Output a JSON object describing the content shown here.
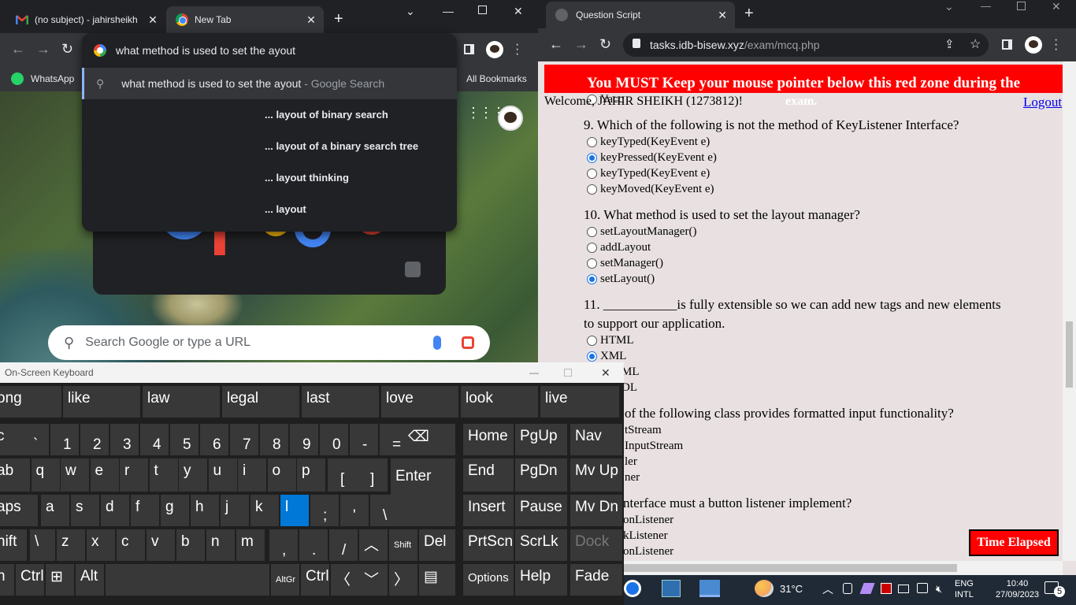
{
  "left_browser": {
    "tabs": [
      {
        "title": "(no subject) - jahirsheikh"
      },
      {
        "title": "New Tab"
      }
    ],
    "bookmarks": {
      "whatsapp": "WhatsApp",
      "all": "All Bookmarks"
    },
    "omnibox": {
      "value": "what method is used to set the ayout",
      "suggestion_main": "what method is used to set the ayout",
      "suggestion_main_suffix": "- Google Search",
      "suggestions": [
        "... layout of binary search",
        "... layout of a binary search tree",
        "... layout thinking",
        "... layout"
      ]
    },
    "ntp_search_placeholder": "Search Google or type a URL"
  },
  "right_browser": {
    "tab_title": "Question Script",
    "url_host": "tasks.idb-bisew.xyz",
    "url_path": "/exam/mcq.php",
    "red_zone_line1": "You MUST Keep your mouse pointer below this red zone during the",
    "red_zone_line2": "exam.",
    "welcome": "Welcome, JAHIR SHEIKH (1273812)!",
    "logout": "Logout",
    "partial_option": "Yacc",
    "questions": [
      {
        "q": "9. Which of the following is not the method of KeyListener Interface?",
        "options": [
          "keyTyped(KeyEvent e)",
          "keyPressed(KeyEvent e)",
          "keyTyped(KeyEvent e)",
          "keyMoved(KeyEvent e)"
        ],
        "selected": 1
      },
      {
        "q": "10. What method is used to set the layout manager?",
        "options": [
          "setLayoutManager()",
          "addLayout",
          "setManager()",
          "setLayout()"
        ],
        "selected": 3
      },
      {
        "q": "11. ___________is fully extensible so we can add new tags and new elements",
        "q2": "to support our application.",
        "options": [
          "HTML",
          "XML",
          "ML",
          "DL"
        ],
        "selected": 1
      },
      {
        "q": "of the following class provides formatted input functionality?",
        "options": [
          "tStream",
          "InputStream",
          "ler",
          "ner"
        ],
        "selected": -1
      },
      {
        "q": "nterface must a button listener implement?",
        "options": [
          "onListener",
          "kListener",
          "onListener"
        ],
        "selected": -1
      }
    ],
    "time_elapsed": "Time Elapsed"
  },
  "osk": {
    "title": "On-Screen Keyboard",
    "predictions": [
      "ong",
      "like",
      "law",
      "legal",
      "last",
      "love",
      "look",
      "live"
    ],
    "row1": [
      [
        "c",
        ""
      ],
      [
        "`",
        "~"
      ],
      [
        "1",
        "!"
      ],
      [
        "2",
        "@"
      ],
      [
        "3",
        "#"
      ],
      [
        "4",
        "$"
      ],
      [
        "5",
        "%"
      ],
      [
        "6",
        "^"
      ],
      [
        "7",
        "&"
      ],
      [
        "8",
        "*"
      ],
      [
        "9",
        "("
      ],
      [
        "0",
        ")"
      ],
      [
        "-",
        "_"
      ],
      [
        "=",
        "+"
      ]
    ],
    "row2": [
      "ab",
      "q",
      "w",
      "e",
      "r",
      "t",
      "y",
      "u",
      "i",
      "o",
      "p"
    ],
    "row2_br": [
      [
        "[",
        "{"
      ],
      [
        "]",
        "}"
      ]
    ],
    "enter": "Enter",
    "row3": [
      "aps",
      "a",
      "s",
      "d",
      "f",
      "g",
      "h",
      "j",
      "k",
      "l"
    ],
    "row3_punct": [
      [
        ";",
        ":"
      ],
      [
        "'",
        "\""
      ],
      [
        "\\",
        "|"
      ]
    ],
    "row4": [
      "hift",
      "\\",
      "z",
      "x",
      "c",
      "v",
      "b",
      "n",
      "m"
    ],
    "row4_punct": [
      [
        ",",
        "<"
      ],
      [
        ".",
        ">"
      ],
      [
        "/",
        "?"
      ]
    ],
    "shift_r": "Shift",
    "del": "Del",
    "row5": {
      "fn": "n",
      "ctrl": "Ctrl",
      "alt": "Alt",
      "altgr": "AltGr",
      "ctrl2": "Ctrl"
    },
    "nav": [
      "Home",
      "PgUp",
      "Nav",
      "End",
      "PgDn",
      "Mv Up",
      "Insert",
      "Pause",
      "Mv Dn",
      "PrtScn",
      "ScrLk",
      "Dock",
      "Options",
      "Help",
      "Fade"
    ]
  },
  "taskbar": {
    "weather": "31°C",
    "lang1": "ENG",
    "lang2": "INTL",
    "time": "10:40",
    "date": "27/09/2023",
    "notif": "5"
  }
}
